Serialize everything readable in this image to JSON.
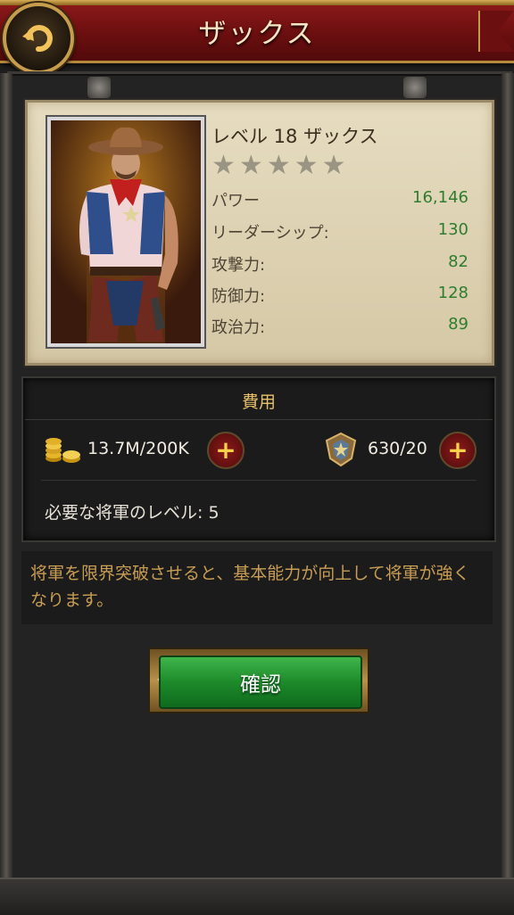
{
  "header": {
    "title": "ザックス"
  },
  "hero": {
    "name": "レベル 18 ザックス",
    "star_count": 5,
    "stars_filled": 0,
    "stats": [
      {
        "label": "パワー",
        "value": "16,146"
      },
      {
        "label": "リーダーシップ:",
        "value": "130"
      },
      {
        "label": "攻撃力:",
        "value": "82"
      },
      {
        "label": "防御力:",
        "value": "128"
      },
      {
        "label": "政治力:",
        "value": "89"
      }
    ]
  },
  "cost": {
    "title": "費用",
    "gold": {
      "icon": "gold-coins-icon",
      "amount": "13.7M/200K"
    },
    "medal": {
      "icon": "medal-badge-icon",
      "amount": "630/20"
    },
    "requirement": "必要な将軍のレベル: 5"
  },
  "description": "将軍を限界突破させると、基本能力が向上して将軍が強くなります。",
  "confirm_label": "確認",
  "colors": {
    "header_red": "#6c0f10",
    "gold_trim": "#c69d4c",
    "stat_green": "#2e7d2e",
    "button_green": "#1d8a2a",
    "desc_orange": "#c89d54"
  }
}
